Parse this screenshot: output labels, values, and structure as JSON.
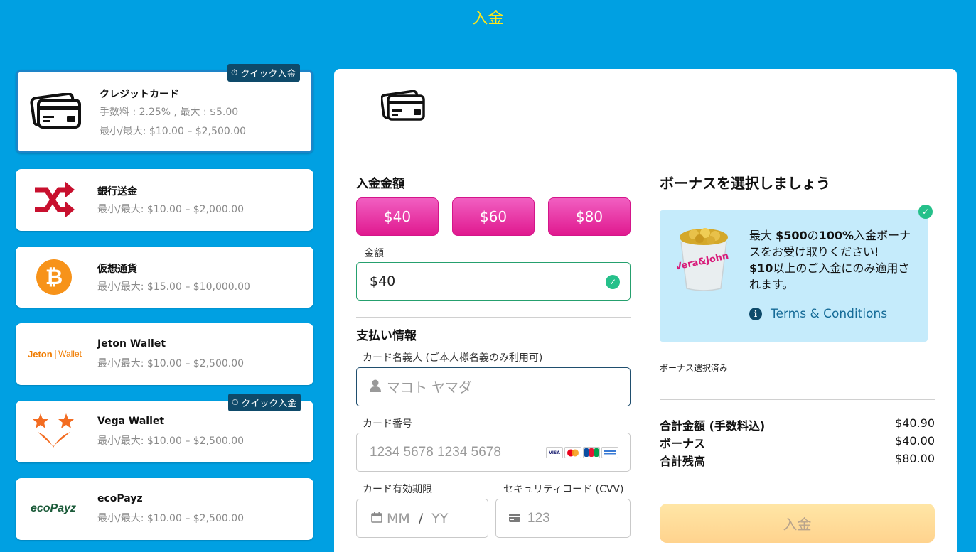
{
  "page_title": "入金",
  "methods": [
    {
      "name": "クレジットカード",
      "fee": "手数料 : 2.25% , 最大 : $5.00",
      "limit": "最小/最大: $10.00 – $2,500.00",
      "badge": "クイック入金",
      "icon": "credit-card-icon"
    },
    {
      "name": "銀行送金",
      "limit": "最小/最大: $10.00 – $2,000.00",
      "icon": "shuffle-arrows-icon"
    },
    {
      "name": "仮想通貨",
      "limit": "最小/最大: $15.00 – $10,000.00",
      "icon": "bitcoin-icon"
    },
    {
      "name": "Jeton Wallet",
      "limit": "最小/最大: $10.00 – $2,500.00",
      "logo_text": "Jeton",
      "logo_text2": "Wallet",
      "icon": "jeton-logo"
    },
    {
      "name": "Vega Wallet",
      "limit": "最小/最大: $10.00 – $2,500.00",
      "badge": "クイック入金",
      "icon": "vega-stars-icon"
    },
    {
      "name": "ecoPayz",
      "limit": "最小/最大: $10.00 – $2,500.00",
      "logo_text": "ecoPayz",
      "icon": "ecopayz-logo"
    }
  ],
  "deposit": {
    "amount_title": "入金金額",
    "presets": [
      "$40",
      "$60",
      "$80"
    ],
    "amount_label": "金額",
    "amount_value": "$40",
    "payment_title": "支払い情報",
    "cardholder_label": "カード名義人 (ご本人様名義のみ利用可)",
    "cardholder_placeholder": "マコト ヤマダ",
    "card_number_label": "カード番号",
    "card_number_placeholder": "1234 5678 1234 5678",
    "card_brands": [
      "VISA",
      "MC",
      "JCB",
      "DINERS"
    ],
    "expiry_label": "カード有効期限",
    "expiry_mm": "MM",
    "expiry_sep": "/",
    "expiry_yy": "YY",
    "cvv_label": "セキュリティコード (CVV)",
    "cvv_placeholder": "123"
  },
  "bonus": {
    "title": "ボーナスを選択しましょう",
    "line1_a": "最大 ",
    "line1_b": "$500",
    "line1_c": "の",
    "line1_d": "100%",
    "line1_e": "入金ボーナスをお受け取りください!",
    "line2_a": "$10",
    "line2_b": "以上のご入金にのみ適用されます。",
    "tc": "Terms & Conditions",
    "selected_note": "ボーナス選択済み",
    "bucket_text": "Vera&John"
  },
  "summary": [
    {
      "label": "合計金額 (手数料込)",
      "value": "$40.90"
    },
    {
      "label": "ボーナス",
      "value": "$40.00"
    },
    {
      "label": "合計残高",
      "value": "$80.00"
    }
  ],
  "submit_label": "入金",
  "colors": {
    "bg": "#00a0e2",
    "title": "#ffe61a",
    "pink": "#e0198f",
    "bonus_bg": "#c5ebfb",
    "check": "#25c08a"
  }
}
